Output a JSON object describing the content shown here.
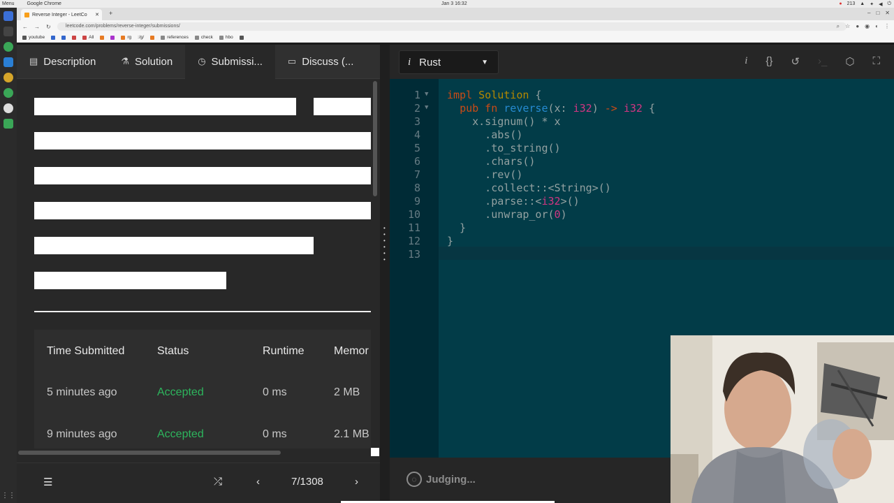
{
  "os": {
    "menu": "Menu",
    "app": "Google Chrome",
    "clock": "Jan 3  16:32",
    "counter": "213"
  },
  "browser": {
    "tab_title": "Reverse Integer - LeetCo",
    "url": "leetcode.com/problems/reverse-integer/submissions/",
    "bookmarks": [
      "youtube",
      "All",
      "rg",
      ":/g/",
      "references",
      "check",
      "hbo"
    ]
  },
  "left": {
    "tabs": [
      {
        "icon": "description-icon",
        "label": "Description"
      },
      {
        "icon": "flask-icon",
        "label": "Solution"
      },
      {
        "icon": "clock-icon",
        "label": "Submissi..."
      },
      {
        "icon": "comment-icon",
        "label": "Discuss (..."
      }
    ],
    "table": {
      "headers": [
        "Time Submitted",
        "Status",
        "Runtime",
        "Memor"
      ],
      "rows": [
        {
          "time": "5 minutes ago",
          "status": "Accepted",
          "runtime": "0 ms",
          "memory": "2 MB"
        },
        {
          "time": "9 minutes ago",
          "status": "Accepted",
          "runtime": "0 ms",
          "memory": "2.1 MB"
        }
      ]
    },
    "footer": {
      "pager": "7/1308"
    }
  },
  "right": {
    "language": "Rust",
    "editor": {
      "line_numbers": [
        "1",
        "2",
        "3",
        "4",
        "5",
        "6",
        "7",
        "8",
        "9",
        "10",
        "11",
        "12",
        "13"
      ]
    },
    "status": "Judging..."
  },
  "colors": {
    "accepted": "#2db55d",
    "editor_bg": "#023c48",
    "gutter_bg": "#002b36"
  }
}
